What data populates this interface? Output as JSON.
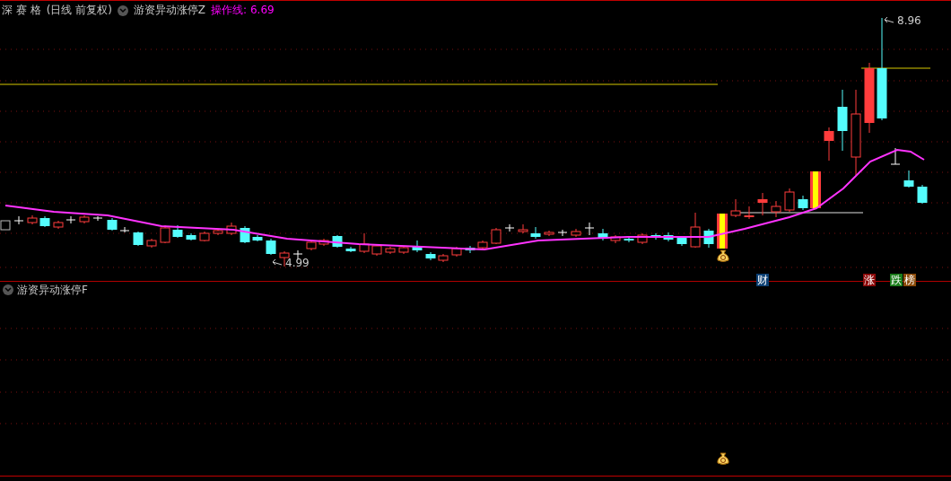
{
  "header": {
    "stock_name": "深 赛 格",
    "period": "(日线 前复权)",
    "indicator": "游资异动涨停Z",
    "line_label": "操作线:",
    "line_value": "6.69"
  },
  "price_marks": [
    {
      "kind": "high",
      "text": "8.96"
    },
    {
      "kind": "low",
      "text": "4.99"
    }
  ],
  "badges": [
    {
      "text": "财",
      "color": "#0b3f73"
    },
    {
      "text": "涨",
      "color": "#8c0a0a"
    },
    {
      "text": "跌",
      "color": "#1b7d1b"
    },
    {
      "text": "榜",
      "color": "#8a4a08"
    }
  ],
  "sub_panel": {
    "title": "游资异动涨停F"
  }
}
